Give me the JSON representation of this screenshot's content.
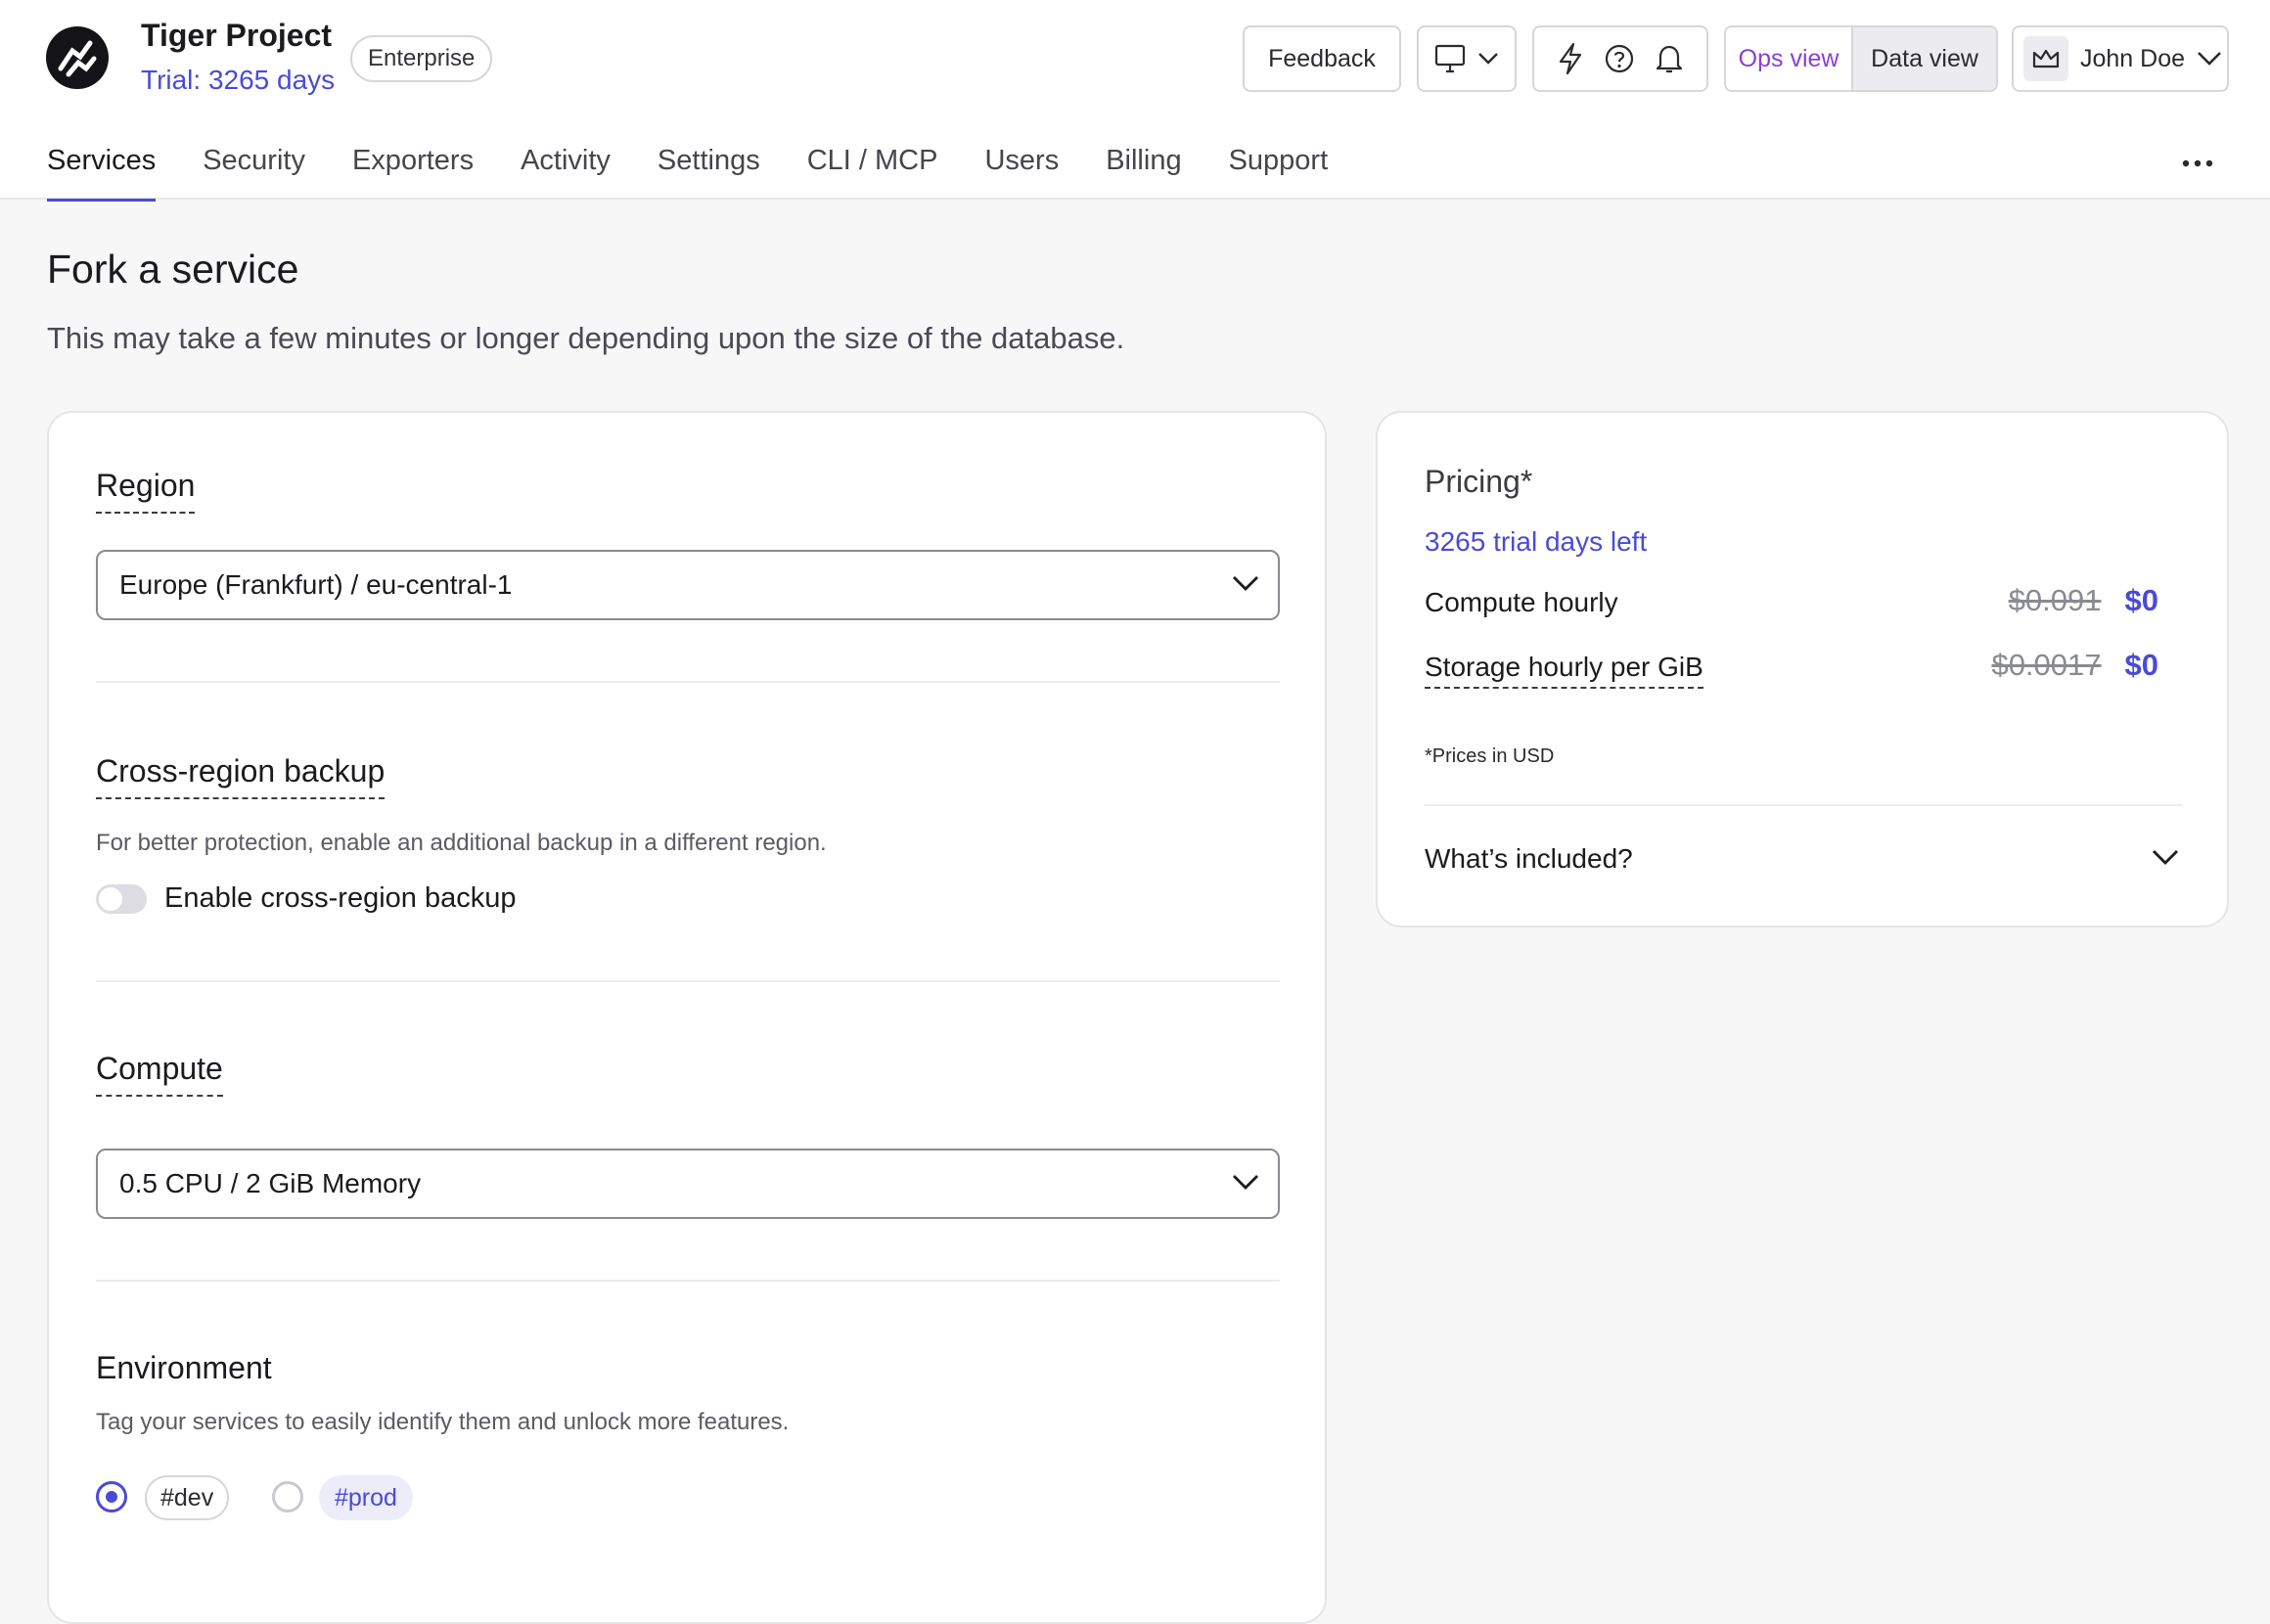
{
  "header": {
    "project_name": "Tiger Project",
    "trial_text": "Trial: 3265 days",
    "plan_badge": "Enterprise",
    "feedback_label": "Feedback",
    "view_toggle": {
      "ops": "Ops view",
      "data": "Data view",
      "selected": "Ops view"
    },
    "user_name": "John Doe"
  },
  "nav": {
    "tabs": [
      {
        "label": "Services",
        "active": true
      },
      {
        "label": "Security"
      },
      {
        "label": "Exporters"
      },
      {
        "label": "Activity"
      },
      {
        "label": "Settings"
      },
      {
        "label": "CLI / MCP"
      },
      {
        "label": "Users"
      },
      {
        "label": "Billing"
      },
      {
        "label": "Support"
      }
    ]
  },
  "page": {
    "title": "Fork a service",
    "subtitle": "This may take a few minutes or longer depending upon the size of the database."
  },
  "form": {
    "region": {
      "label": "Region",
      "value": "Europe (Frankfurt) / eu-central-1"
    },
    "backup": {
      "label": "Cross-region backup",
      "help": "For better protection, enable an additional backup in a different region.",
      "toggle_label": "Enable cross-region backup",
      "enabled": false
    },
    "compute": {
      "label": "Compute",
      "value": "0.5 CPU / 2 GiB Memory"
    },
    "environment": {
      "label": "Environment",
      "help": "Tag your services to easily identify them and unlock more features.",
      "options": [
        "#dev",
        "#prod"
      ],
      "selected": "#dev"
    }
  },
  "pricing": {
    "title": "Pricing*",
    "trial_left": "3265 trial days left",
    "rows": [
      {
        "label": "Compute hourly",
        "old": "$0.091",
        "new": "$0"
      },
      {
        "label": "Storage hourly per GiB",
        "old": "$0.0017",
        "new": "$0"
      }
    ],
    "note": "*Prices in USD",
    "included_label": "What’s included?"
  },
  "colors": {
    "accent": "#4a4ad9",
    "ops_view": "#8a3fd8"
  }
}
